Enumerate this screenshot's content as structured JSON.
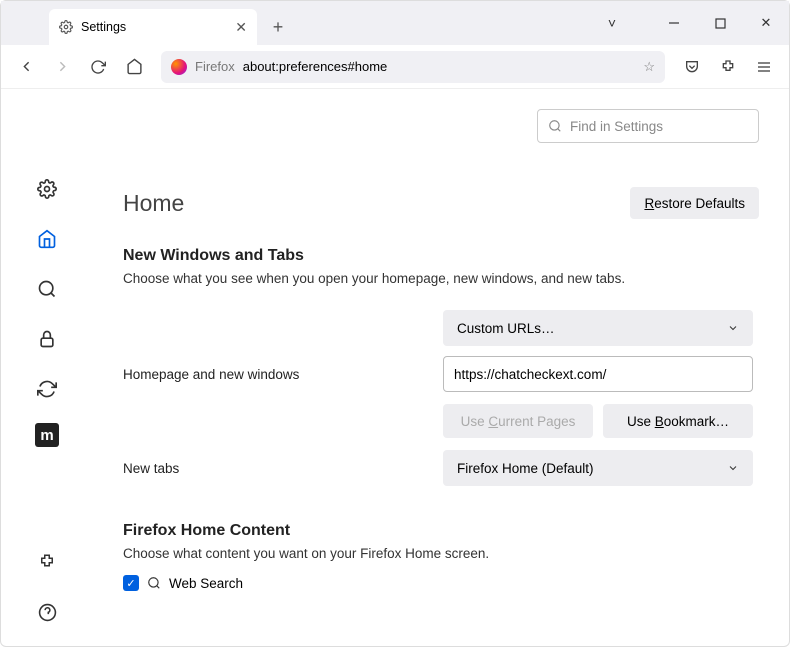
{
  "tab": {
    "title": "Settings"
  },
  "urlbar": {
    "brand": "Firefox",
    "url": "about:preferences#home"
  },
  "find": {
    "placeholder": "Find in Settings"
  },
  "page": {
    "title": "Home"
  },
  "buttons": {
    "restore": "Restore Defaults",
    "use_current": "Use Current Pages",
    "use_bookmark": "Use Bookmark…"
  },
  "section1": {
    "heading": "New Windows and Tabs",
    "desc": "Choose what you see when you open your homepage, new windows, and new tabs."
  },
  "homepage": {
    "label": "Homepage and new windows",
    "select": "Custom URLs…",
    "value": "https://chatcheckext.com/"
  },
  "newtabs": {
    "label": "New tabs",
    "select": "Firefox Home (Default)"
  },
  "section2": {
    "heading": "Firefox Home Content",
    "desc": "Choose what content you want on your Firefox Home screen."
  },
  "checks": {
    "web_search": "Web Search"
  }
}
